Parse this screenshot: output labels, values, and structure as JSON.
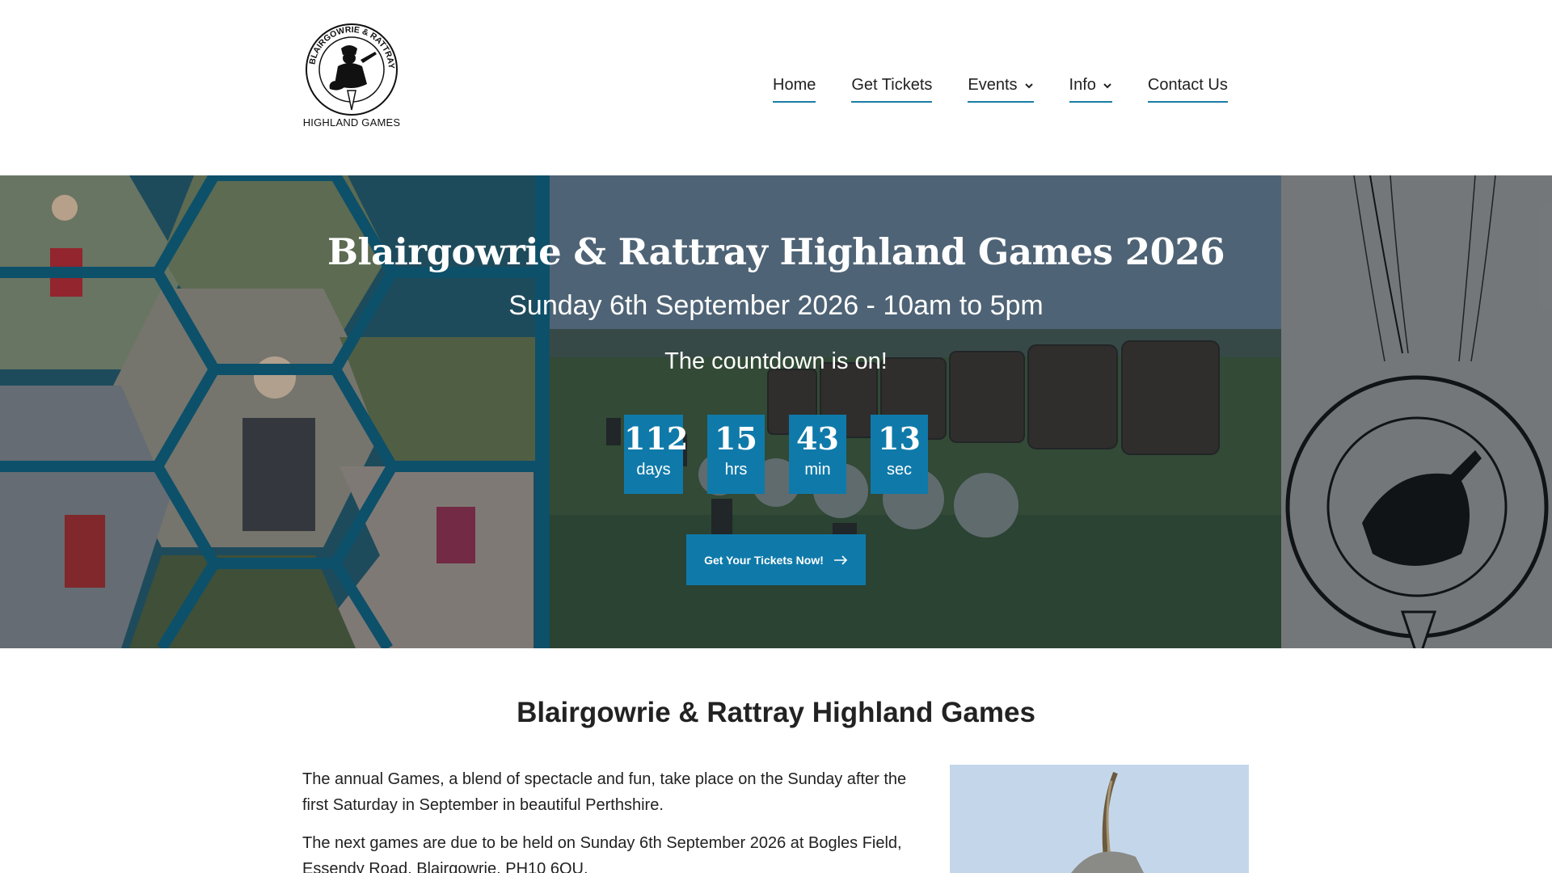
{
  "header": {
    "logo_text": "HIGHLAND GAMES",
    "logo_ring_text": "BLAIRGOWRIE & RATTRAY",
    "nav": [
      {
        "label": "Home",
        "has_dropdown": false
      },
      {
        "label": "Get Tickets",
        "has_dropdown": false
      },
      {
        "label": "Events",
        "has_dropdown": true
      },
      {
        "label": "Info",
        "has_dropdown": true
      },
      {
        "label": "Contact Us",
        "has_dropdown": false
      }
    ]
  },
  "hero": {
    "title": "Blairgowrie & Rattray Highland Games 2026",
    "subtitle": "Sunday 6th September 2026 - 10am to 5pm",
    "countdown_heading": "The countdown is on!",
    "countdown": [
      {
        "value": "112",
        "unit": "days"
      },
      {
        "value": "15",
        "unit": "hrs"
      },
      {
        "value": "43",
        "unit": "min"
      },
      {
        "value": "13",
        "unit": "sec"
      }
    ],
    "cta_label": "Get Your Tickets Now!",
    "cta_icon": "arrow-right-icon"
  },
  "content": {
    "title": "Blairgowrie & Rattray Highland Games",
    "paragraph1": "The annual Games, a blend of spectacle and fun, take place on the Sunday after the first Saturday in September in beautiful Perthshire.",
    "paragraph2": "The next games are due to be held on Sunday 6th September 2026 at Bogles Field, Essendy Road, Blairgowrie, PH10 6QU."
  },
  "colors": {
    "accent": "#0f7aaa",
    "nav_underline": "#1b7da6",
    "text": "#222222"
  }
}
